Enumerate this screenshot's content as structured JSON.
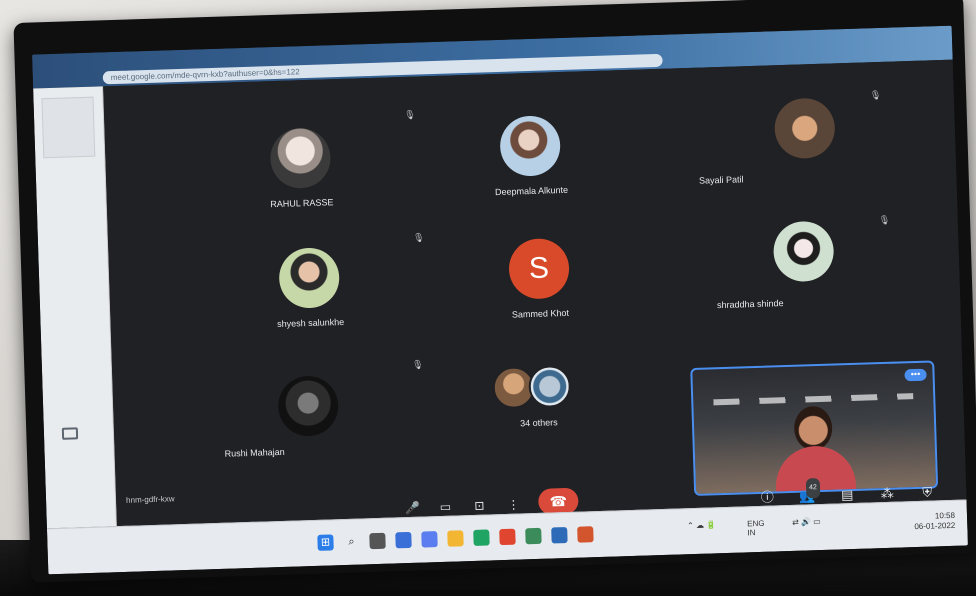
{
  "browser": {
    "address": "meet.google.com/mde-qvrn-kxb?authuser=0&hs=122"
  },
  "participants": [
    {
      "name": "RAHUL RASSE",
      "avatar": "photo"
    },
    {
      "name": "Deepmala Alkunte",
      "avatar": "photo"
    },
    {
      "name": "Sayali Patil",
      "avatar": "photo"
    },
    {
      "name": "shyesh salunkhe",
      "avatar": "photo"
    },
    {
      "name": "Sammed Khot",
      "avatar": "letter",
      "letter": "S"
    },
    {
      "name": "shraddha shinde",
      "avatar": "photo"
    },
    {
      "name": "Rushi Mahajan",
      "avatar": "photo"
    },
    {
      "name": "34 others",
      "avatar": "group"
    }
  ],
  "meeting": {
    "label": "hnm-gdfr-kxw",
    "participant_count": "42"
  },
  "controls": {
    "mic_icon": "microphone-icon",
    "camera_icon": "camera-icon",
    "present_icon": "present-icon",
    "more_icon": "more-options-icon",
    "end_call_icon": "end-call-icon",
    "info_icon": "info-icon",
    "people_icon": "people-icon",
    "chat_icon": "chat-icon",
    "activities_icon": "activities-icon",
    "host_icon": "host-controls-icon"
  },
  "taskbar": {
    "language": "ENG",
    "language_sub": "IN",
    "time": "10:58",
    "date": "06-01-2022"
  },
  "colors": {
    "end_call": "#d94a3b",
    "letter_avatar": "#d94a2b",
    "self_view_border": "#4a8ff0"
  }
}
